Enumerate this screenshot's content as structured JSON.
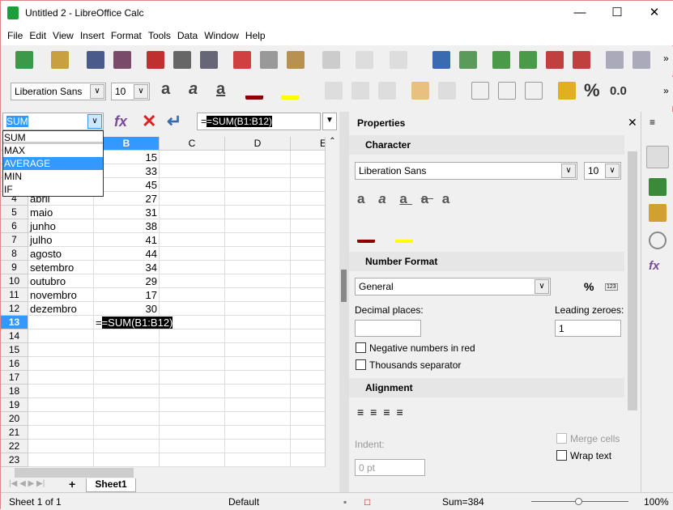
{
  "window": {
    "title": "Untitled 2 - LibreOffice Calc"
  },
  "menu": [
    "File",
    "Edit",
    "View",
    "Insert",
    "Format",
    "Tools",
    "Data",
    "Window",
    "Help"
  ],
  "format_toolbar": {
    "font_name": "Liberation Sans",
    "font_size": "10",
    "number_format_value": "0.0",
    "percent": "%"
  },
  "formula_bar": {
    "name_box": "SUM",
    "formula": "=SUM(B1:B12)"
  },
  "function_dropdown": {
    "items": [
      "SUM",
      "MAX",
      "AVERAGE",
      "MIN",
      "IF"
    ],
    "highlighted": "AVERAGE"
  },
  "grid": {
    "columns": [
      "B",
      "C",
      "D",
      "E"
    ],
    "rows": [
      {
        "n": "",
        "a": "",
        "b": "15"
      },
      {
        "n": "",
        "a": "",
        "b": "33"
      },
      {
        "n": "",
        "a": "",
        "b": "45"
      },
      {
        "n": "4",
        "a": "abril",
        "b": "27"
      },
      {
        "n": "5",
        "a": "maio",
        "b": "31"
      },
      {
        "n": "6",
        "a": "junho",
        "b": "38"
      },
      {
        "n": "7",
        "a": "julho",
        "b": "41"
      },
      {
        "n": "8",
        "a": "agosto",
        "b": "44"
      },
      {
        "n": "9",
        "a": "setembro",
        "b": "34"
      },
      {
        "n": "10",
        "a": "outubro",
        "b": "29"
      },
      {
        "n": "11",
        "a": "novembro",
        "b": "17"
      },
      {
        "n": "12",
        "a": "dezembro",
        "b": "30"
      },
      {
        "n": "13",
        "a": "",
        "b": "=SUM(B1:B12)"
      },
      {
        "n": "14"
      },
      {
        "n": "15"
      },
      {
        "n": "16"
      },
      {
        "n": "17"
      },
      {
        "n": "18"
      },
      {
        "n": "19"
      },
      {
        "n": "20"
      },
      {
        "n": "21"
      },
      {
        "n": "22"
      },
      {
        "n": "23"
      }
    ]
  },
  "sheet_tab": "Sheet1",
  "sidebar": {
    "title": "Properties",
    "character": {
      "title": "Character",
      "font": "Liberation Sans",
      "size": "10"
    },
    "number_format": {
      "title": "Number Format",
      "format": "General",
      "decimal_label": "Decimal places:",
      "leading_label": "Leading zeroes:",
      "leading_value": "1",
      "negative_red": "Negative numbers in red",
      "thousands": "Thousands separator",
      "percent": "%",
      "code": "123"
    },
    "alignment": {
      "title": "Alignment",
      "indent_label": "Indent:",
      "indent_value": "0 pt",
      "merge": "Merge cells",
      "wrap": "Wrap text"
    }
  },
  "status": {
    "sheet": "Sheet 1 of 1",
    "style": "Default",
    "sum": "Sum=384",
    "zoom": "100%",
    "zoom_percent": 100
  },
  "colors": {
    "selection": "#3399ff",
    "highlight": "#cce8ff",
    "accent_red": "#e02020"
  }
}
